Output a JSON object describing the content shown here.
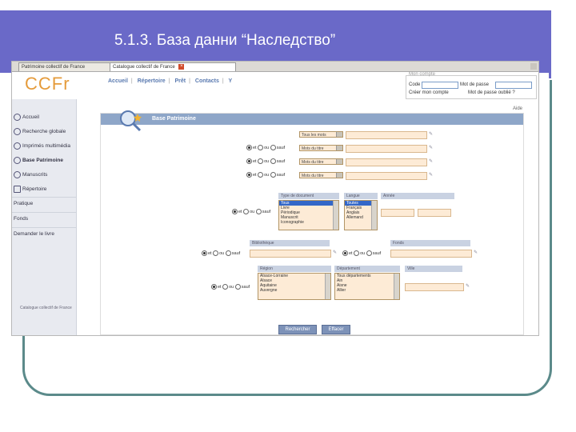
{
  "slide": {
    "title": "5.1.3. База данни “Наследство”"
  },
  "browser": {
    "tabs": [
      {
        "label": "Patrimoine collectif de France"
      },
      {
        "label": "Catalogue collectif de France"
      }
    ],
    "close_glyph": "×"
  },
  "site": {
    "logo": "CCFr",
    "nav": [
      "Accueil",
      "Répertoire",
      "Prêt",
      "Contacts",
      "Y"
    ],
    "nav_sep": "|",
    "account": {
      "legend": "Mon compte",
      "code_label": "Code",
      "password_label": "Mot de passe",
      "create_label": "Créer mon compte",
      "forgot_label": "Mot de passe oublié ?"
    },
    "sidebar": {
      "items": [
        {
          "label": "Accueil",
          "icon": "search-icon"
        },
        {
          "label": "Recherche globale",
          "icon": "search-icon"
        },
        {
          "label": "Imprimés multimédia",
          "icon": "search-icon"
        },
        {
          "label": "Base Patrimoine",
          "icon": "search-icon"
        },
        {
          "label": "Manuscrits",
          "icon": "search-icon"
        },
        {
          "label": "Répertoire",
          "icon": "book-icon"
        },
        {
          "label": "Pratique",
          "icon": ""
        },
        {
          "label": "Fonds",
          "icon": ""
        },
        {
          "label": "Demander le livre",
          "icon": ""
        }
      ],
      "footer": "Catalogue collectif de France"
    }
  },
  "form": {
    "help": "Aide",
    "title": "Base Patrimoine",
    "rows": [
      {
        "op": null,
        "select": "Tous les mots"
      },
      {
        "op": [
          "et",
          "ou",
          "sauf"
        ],
        "select": "Mots du titre"
      },
      {
        "op": [
          "et",
          "ou",
          "sauf"
        ],
        "select": "Mots du titre"
      },
      {
        "op": [
          "et",
          "ou",
          "sauf"
        ],
        "select": "Mots du titre"
      }
    ],
    "doc_type": {
      "label": "Type de document",
      "options": [
        "Tous",
        "Livre",
        "Périodique",
        "Manuscrit",
        "Iconographie"
      ]
    },
    "langue": {
      "label": "Langue",
      "options": [
        "Toutes",
        "Français",
        "Anglais",
        "Allemand"
      ]
    },
    "annee": {
      "label": "Année"
    },
    "bibliotheque": {
      "label": "Bibliothèque"
    },
    "fonds": {
      "label": "Fonds"
    },
    "region": {
      "label": "Région",
      "options": [
        "Alsace-Lorraine",
        "Alsace",
        "Aquitaine",
        "Auvergne"
      ]
    },
    "departement": {
      "label": "Département",
      "options": [
        "Tous départements",
        "Ain",
        "Aisne",
        "Allier"
      ]
    },
    "ville": {
      "label": "Ville"
    },
    "radio_short": [
      "et",
      "ou",
      "sauf"
    ],
    "buttons": {
      "search": "Rechercher",
      "clear": "Effacer"
    }
  }
}
